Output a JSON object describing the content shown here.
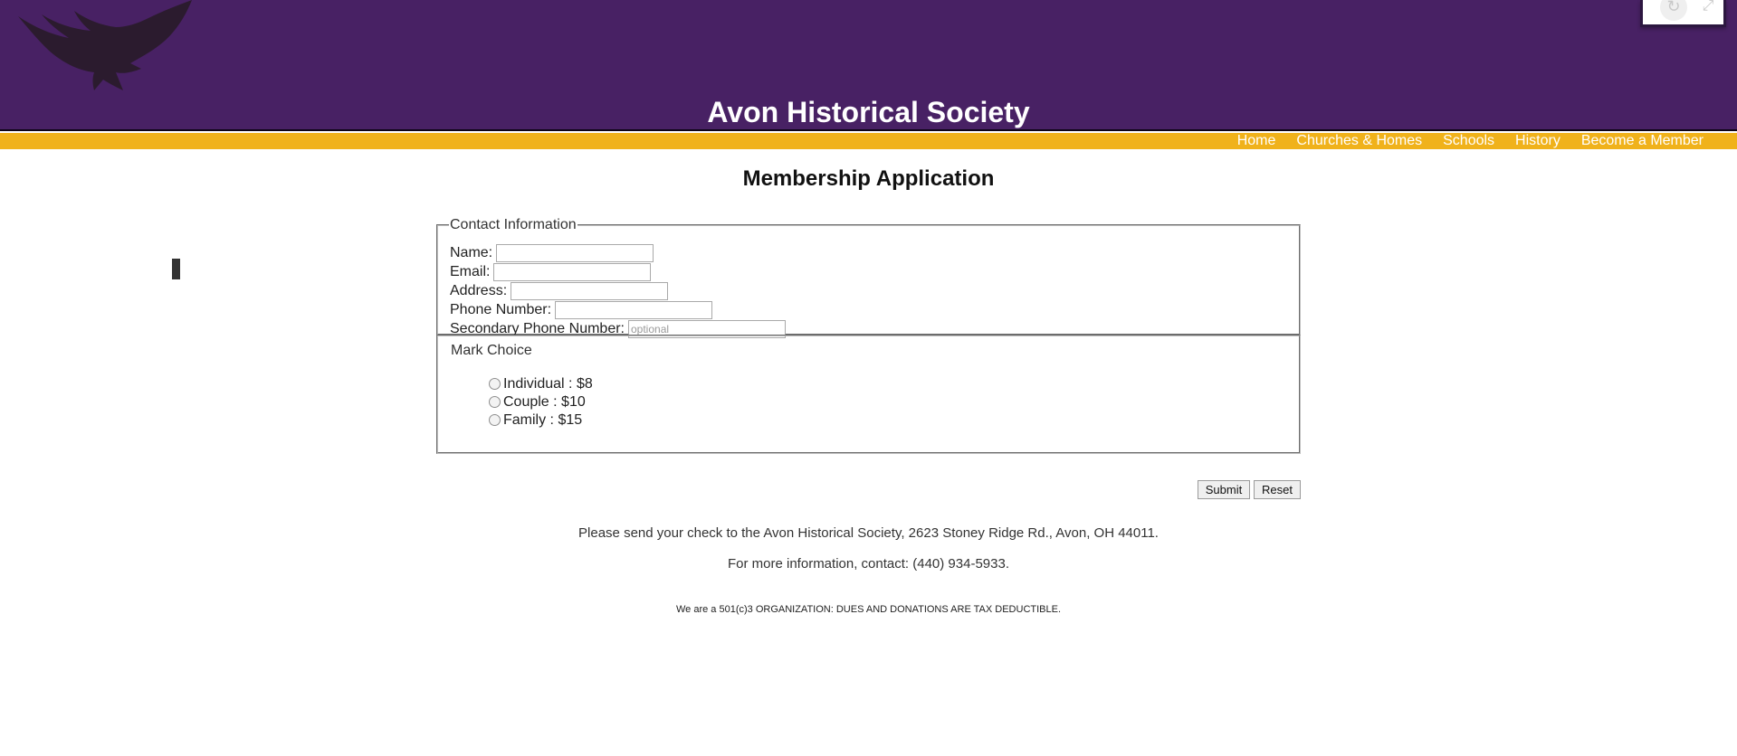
{
  "header": {
    "title": "Avon Historical Society",
    "logo_icon": "eagle-logo-icon",
    "background_color": "#482164",
    "widget": {
      "refresh_icon": "refresh-icon",
      "collapse_icon": "collapse-icon"
    }
  },
  "nav": {
    "background_color": "#f0b21b",
    "items": [
      {
        "label": "Home"
      },
      {
        "label": "Churches & Homes"
      },
      {
        "label": "Schools"
      },
      {
        "label": "History"
      },
      {
        "label": "Become a Member"
      }
    ]
  },
  "main": {
    "heading": "Membership Application",
    "contact": {
      "legend": "Contact Information",
      "fields": [
        {
          "label": "Name:",
          "value": "",
          "placeholder": ""
        },
        {
          "label": "Email:",
          "value": "",
          "placeholder": ""
        },
        {
          "label": "Address:",
          "value": "",
          "placeholder": ""
        },
        {
          "label": "Phone Number:",
          "value": "",
          "placeholder": ""
        },
        {
          "label": "Secondary Phone Number:",
          "value": "",
          "placeholder": "optional"
        }
      ]
    },
    "choice": {
      "legend": "Mark Choice",
      "options": [
        {
          "label": "Individual : $8",
          "selected": false
        },
        {
          "label": "Couple : $10",
          "selected": false
        },
        {
          "label": "Family : $15",
          "selected": false
        }
      ]
    },
    "buttons": {
      "submit": "Submit",
      "reset": "Reset"
    },
    "check_note": "Please send your check to the Avon Historical Society, 2623 Stoney Ridge Rd., Avon, OH 44011.",
    "contact_note": "For more information, contact: (440) 934-5933.",
    "tax_note": "We are a 501(c)3 ORGANIZATION: DUES AND DONATIONS ARE TAX DEDUCTIBLE."
  }
}
